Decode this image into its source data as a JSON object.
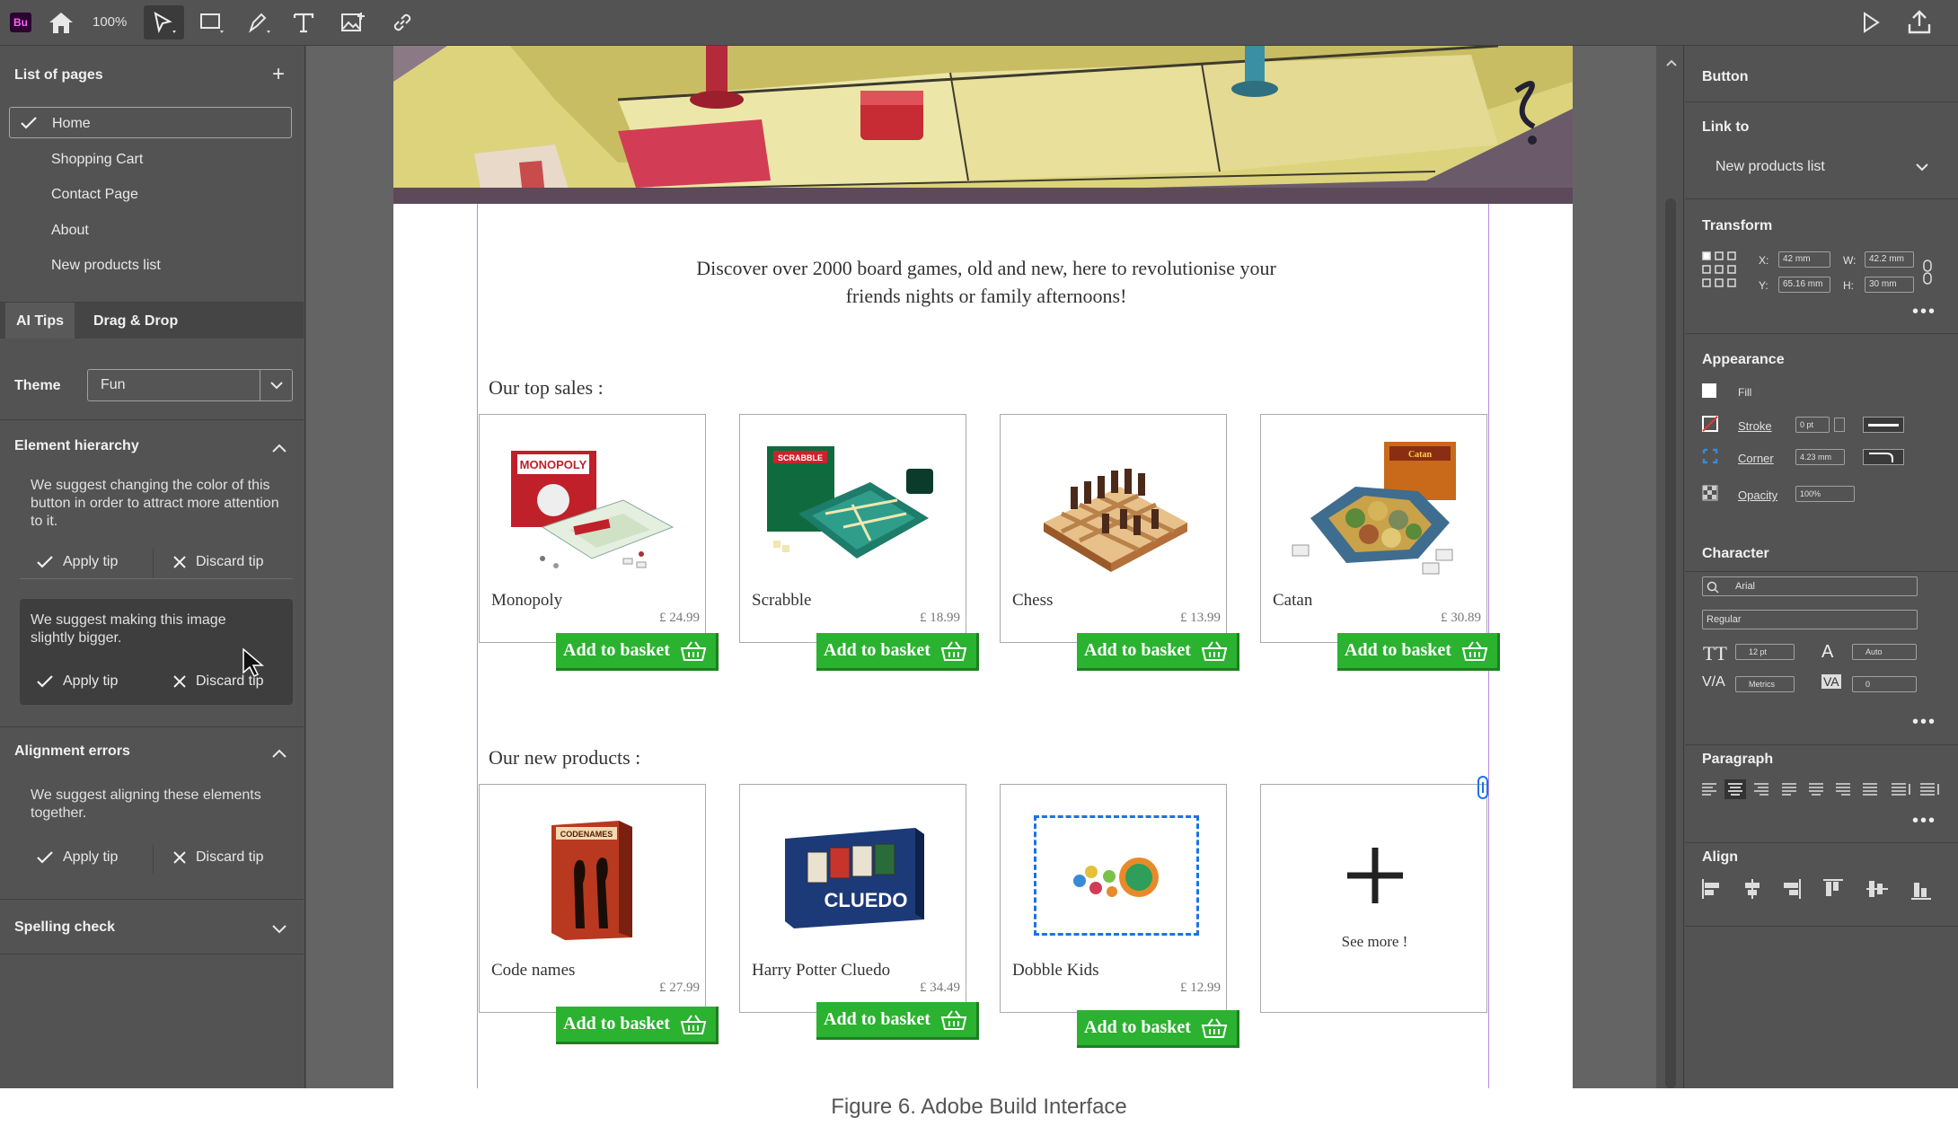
{
  "app": {
    "logo_text": "Bu",
    "zoom": "100%"
  },
  "toolbar_icons": [
    "home-icon",
    "select-tool-icon",
    "rectangle-tool-icon",
    "pen-tool-icon",
    "text-tool-icon",
    "image-tool-icon",
    "link-tool-icon",
    "play-icon",
    "export-icon"
  ],
  "pages": {
    "title": "List of pages",
    "items": [
      {
        "label": "Home",
        "selected": true
      },
      {
        "label": "Shopping Cart"
      },
      {
        "label": "Contact Page"
      },
      {
        "label": "About"
      },
      {
        "label": "New products list"
      }
    ]
  },
  "tabs": [
    {
      "label": "AI Tips"
    },
    {
      "label": "Drag & Drop"
    }
  ],
  "theme": {
    "label": "Theme",
    "value": "Fun"
  },
  "hierarchy": {
    "title": "Element hierarchy",
    "tip1": "We suggest changing the color of this button in order to attract more attention to it.",
    "tip2": "We suggest making this image slightly bigger.",
    "apply": "Apply tip",
    "discard": "Discard tip"
  },
  "alignment": {
    "title": "Alignment errors",
    "tip": "We suggest aligning these elements together.",
    "apply": "Apply tip",
    "discard": "Discard tip"
  },
  "spelling": {
    "title": "Spelling check"
  },
  "canvas": {
    "intro": "Discover over 2000 board games, old and new, here to revolutionise your friends nights or family afternoons!",
    "top_sales_title": "Our top sales :",
    "new_products_title": "Our new products :",
    "button_label": "Add to basket",
    "see_more": "See more !",
    "top_sales": [
      {
        "name": "Monopoly",
        "price": "£ 24.99"
      },
      {
        "name": "Scrabble",
        "price": "£ 18.99"
      },
      {
        "name": "Chess",
        "price": "£ 13.99"
      },
      {
        "name": "Catan",
        "price": "£ 30.89"
      }
    ],
    "new_products": [
      {
        "name": "Code names",
        "price": "£ 27.99"
      },
      {
        "name": "Harry Potter Cluedo",
        "price": "£ 34.49"
      },
      {
        "name": "Dobble Kids",
        "price": "£ 12.99"
      }
    ],
    "box_texts": {
      "monopoly": "MONOPOLY",
      "scrabble": "SCRABBLE",
      "catan": "Catan",
      "codenames": "CODENAMES",
      "cluedo": "CLUEDO"
    }
  },
  "props": {
    "element": "Button",
    "link_to_label": "Link to",
    "link_to_value": "New products list",
    "transform": {
      "title": "Transform",
      "x_label": "X:",
      "x": "42 mm",
      "y_label": "Y:",
      "y": "65.16 mm",
      "w_label": "W:",
      "w": "42.2 mm",
      "h_label": "H:",
      "h": "30 mm"
    },
    "appearance": {
      "title": "Appearance",
      "fill": "Fill",
      "stroke": "Stroke",
      "stroke_value": "0 pt",
      "corner": "Corner",
      "corner_value": "4.23 mm",
      "opacity": "Opacity",
      "opacity_value": "100%"
    },
    "character": {
      "title": "Character",
      "font": "Arial",
      "style": "Regular",
      "size": "12 pt",
      "leading": "Auto",
      "kerning": "Metrics",
      "tracking": "0"
    },
    "paragraph": {
      "title": "Paragraph"
    },
    "align": {
      "title": "Align"
    }
  },
  "caption": "Figure 6. Adobe Build Interface",
  "colors": {
    "accent_green": "#2bb230",
    "guide": "#b48be8",
    "selection_blue": "#1a73e8"
  }
}
